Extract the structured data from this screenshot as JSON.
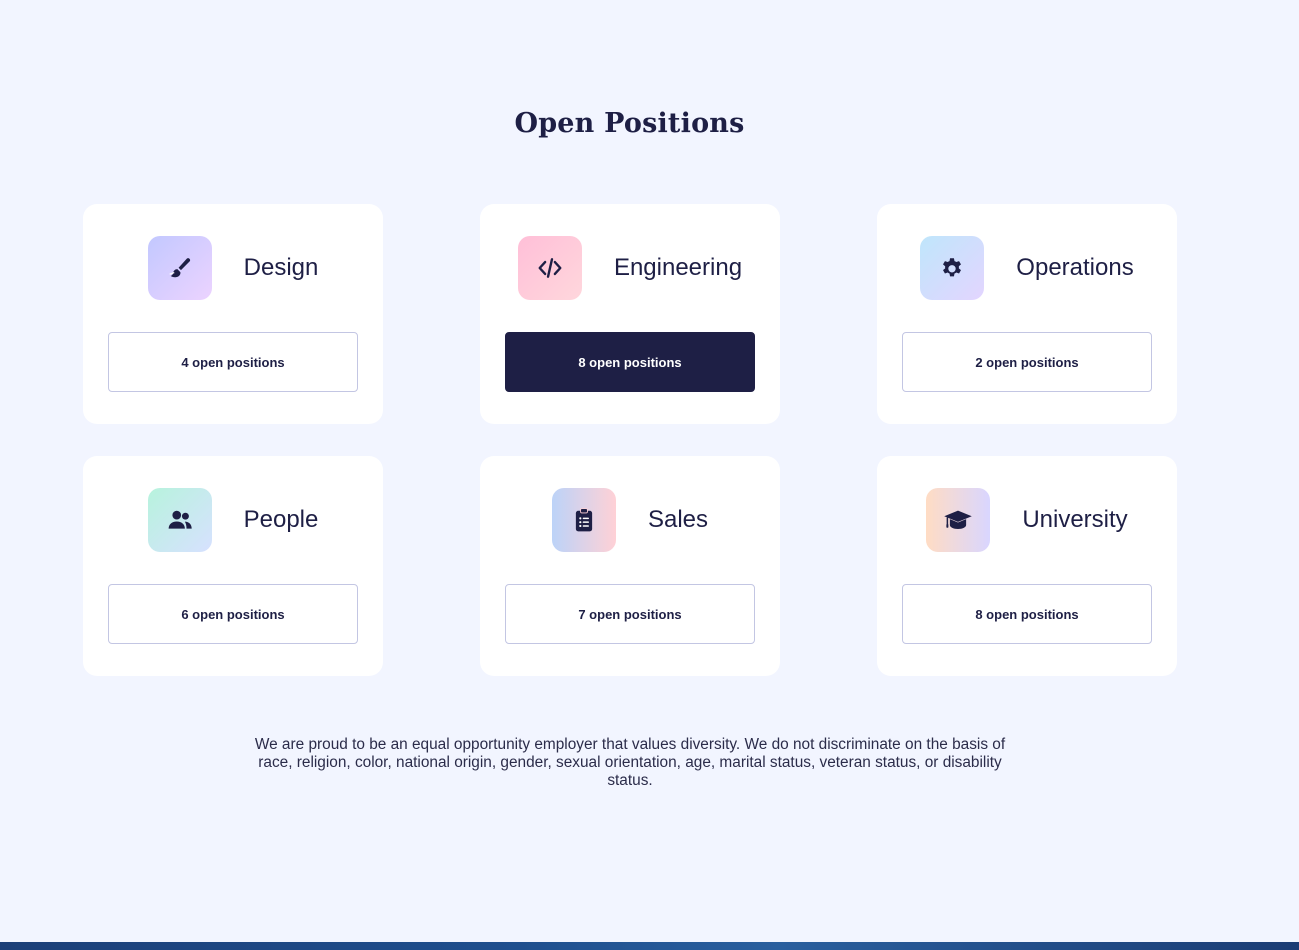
{
  "section": {
    "title": "Open Positions"
  },
  "departments": [
    {
      "name": "Design",
      "positions": "4 open positions",
      "icon": "paintbrush-icon",
      "selected": false
    },
    {
      "name": "Engineering",
      "positions": "8 open positions",
      "icon": "code-icon",
      "selected": true
    },
    {
      "name": "Operations",
      "positions": "2 open positions",
      "icon": "gear-icon",
      "selected": false
    },
    {
      "name": "People",
      "positions": "6 open positions",
      "icon": "users-icon",
      "selected": false
    },
    {
      "name": "Sales",
      "positions": "7 open positions",
      "icon": "clipboard-list-icon",
      "selected": false
    },
    {
      "name": "University",
      "positions": "8 open positions",
      "icon": "graduation-cap-icon",
      "selected": false
    }
  ],
  "statement": "We are proud to be an equal opportunity employer that values diversity. We do not discriminate on the basis of race, religion, color, national origin, gender, sexual orientation, age, marital status, veteran status, or disability status.",
  "colors": {
    "background": "#f2f5ff",
    "text": "#1e1f45",
    "accent": "#1e1f45",
    "card": "#ffffff"
  }
}
